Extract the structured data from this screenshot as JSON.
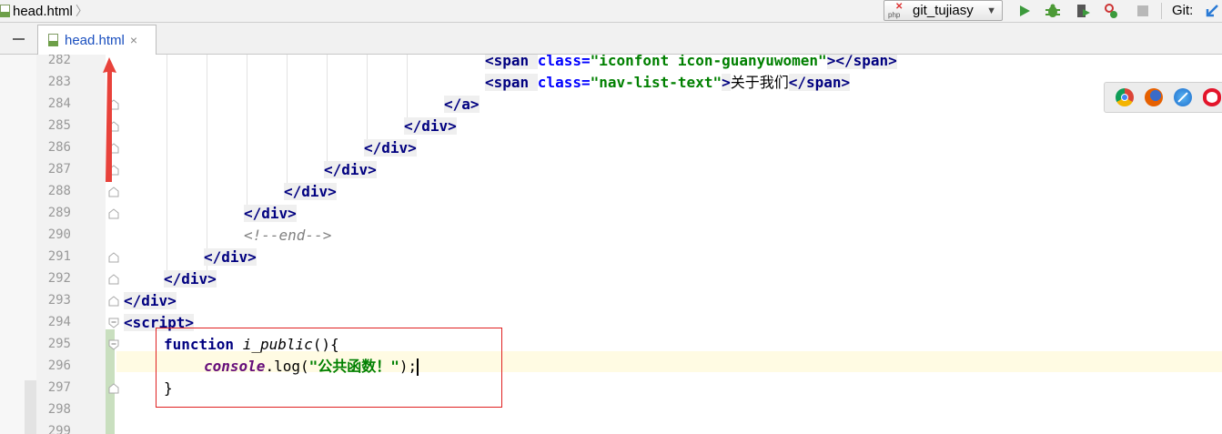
{
  "breadcrumb": {
    "file": "head.html"
  },
  "toolbar": {
    "run_config": "git_tujiasy",
    "run_config_badge": "php",
    "git_label": "Git:",
    "icons": [
      "run-icon",
      "debug-icon",
      "coverage-icon",
      "profile-icon",
      "stop-icon",
      "git-update-icon"
    ]
  },
  "tab": {
    "name": "head.html",
    "close": "×"
  },
  "editor": {
    "lines": [
      {
        "num": "282",
        "segments": [
          {
            "t": "<span ",
            "c": "tag"
          },
          {
            "t": "class=",
            "c": "attr"
          },
          {
            "t": "\"iconfont icon-guanyuwomen\"",
            "c": "str"
          },
          {
            "t": "></span>",
            "c": "tag"
          }
        ]
      },
      {
        "num": "283",
        "segments": [
          {
            "t": "<span ",
            "c": "tag"
          },
          {
            "t": "class=",
            "c": "attr"
          },
          {
            "t": "\"nav-list-text\"",
            "c": "str"
          },
          {
            "t": ">",
            "c": "tag"
          },
          {
            "t": "关于我们",
            "c": "txt"
          },
          {
            "t": "</span>",
            "c": "tag"
          }
        ]
      },
      {
        "num": "284",
        "segments": [
          {
            "t": "</a>",
            "c": "tag"
          }
        ]
      },
      {
        "num": "285",
        "segments": [
          {
            "t": "</div>",
            "c": "tag"
          }
        ]
      },
      {
        "num": "286",
        "segments": [
          {
            "t": "</div>",
            "c": "tag"
          }
        ]
      },
      {
        "num": "287",
        "segments": [
          {
            "t": "</div>",
            "c": "tag"
          }
        ]
      },
      {
        "num": "288",
        "segments": [
          {
            "t": "</div>",
            "c": "tag"
          }
        ]
      },
      {
        "num": "289",
        "segments": [
          {
            "t": "</div>",
            "c": "tag"
          }
        ]
      },
      {
        "num": "290",
        "segments": [
          {
            "t": "<!--end-->",
            "c": "cmt"
          }
        ]
      },
      {
        "num": "291",
        "segments": [
          {
            "t": "</div>",
            "c": "tag"
          }
        ]
      },
      {
        "num": "292",
        "segments": [
          {
            "t": "</div>",
            "c": "tag"
          }
        ]
      },
      {
        "num": "293",
        "segments": [
          {
            "t": "</div>",
            "c": "tag"
          }
        ]
      },
      {
        "num": "294",
        "segments": [
          {
            "t": "<script>",
            "c": "tag"
          }
        ]
      },
      {
        "num": "295",
        "segments": [
          {
            "t": "function ",
            "c": "kw"
          },
          {
            "t": "i_public",
            "c": "fn"
          },
          {
            "t": "(){",
            "c": "txt"
          }
        ]
      },
      {
        "num": "296",
        "segments": [
          {
            "t": "console",
            "c": "obj"
          },
          {
            "t": ".",
            "c": "txt"
          },
          {
            "t": "log",
            "c": "meth"
          },
          {
            "t": "(",
            "c": "txt"
          },
          {
            "t": "\"公共函数！\"",
            "c": "str"
          },
          {
            "t": ");",
            "c": "txt"
          }
        ]
      },
      {
        "num": "297",
        "segments": [
          {
            "t": "}",
            "c": "txt"
          }
        ]
      },
      {
        "num": "298",
        "segments": []
      },
      {
        "num": "299",
        "segments": []
      }
    ]
  },
  "browser_icons": [
    "chrome-icon",
    "firefox-icon",
    "safari-icon",
    "opera-icon"
  ],
  "colors": {
    "tag": "#000080",
    "attribute": "#0000ff",
    "string": "#008000",
    "comment": "#808080",
    "annotation_box": "#e02020",
    "annotation_arrow": "#e8423b",
    "caret_line": "#fffbe3",
    "change_bar": "#c9dfbf"
  }
}
